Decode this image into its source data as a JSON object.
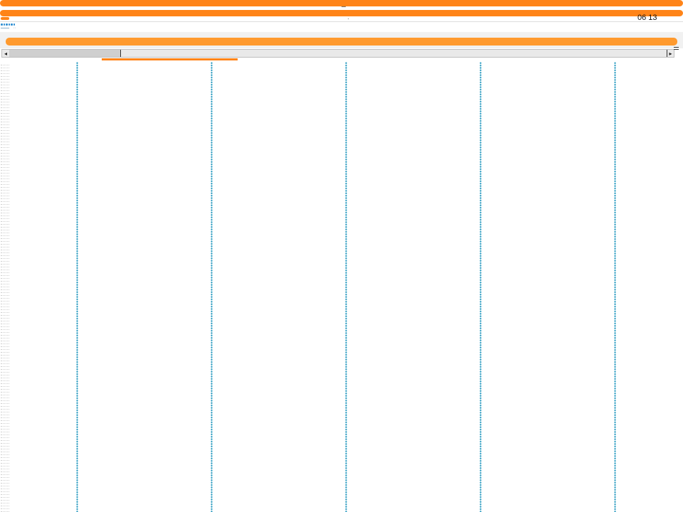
{
  "header": {
    "clock": "06 13"
  },
  "colors": {
    "accent_orange": "#ff8418",
    "accent_orange_light": "#ff9a2e",
    "dot_blue": "#2f8fd3",
    "dot_teal": "#2a9bc0"
  },
  "toolbar": {
    "dots_count": 6
  },
  "scrollbar": {
    "left_arrow": "◂",
    "right_arrow": "▸",
    "thumb_fraction": 0.17,
    "icon": "menu-icon"
  },
  "grid": {
    "columns": [
      {
        "name": "column-1"
      },
      {
        "name": "column-2"
      },
      {
        "name": "column-3"
      },
      {
        "name": "column-4"
      },
      {
        "name": "column-5"
      }
    ]
  }
}
